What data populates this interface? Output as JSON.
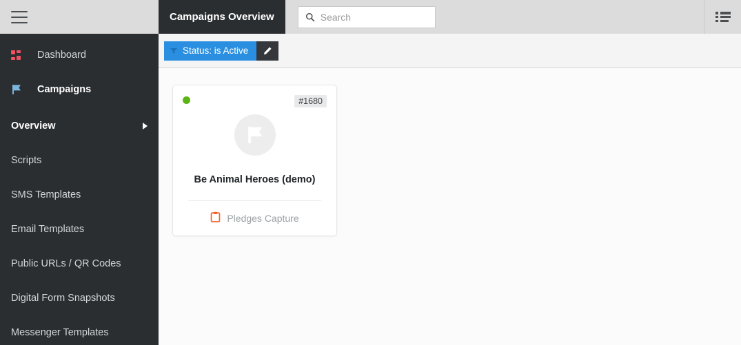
{
  "colors": {
    "sidebar_bg": "#2b2e31",
    "header_bg": "#dcdcdc",
    "accent_blue": "#2a8fe0",
    "status_green": "#5cb415",
    "dashboard_icon": "#ef5261",
    "campaigns_icon": "#7cb5dd",
    "pledges_icon": "#f4622a"
  },
  "sidebar": {
    "menu_toggle_icon": "hamburger-icon",
    "main_items": [
      {
        "label": "Dashboard",
        "icon": "grid-icon",
        "active": false
      },
      {
        "label": "Campaigns",
        "icon": "flag-icon",
        "active": true
      }
    ],
    "sub_items": [
      {
        "label": "Overview",
        "active": true,
        "caret": "caret-right-icon"
      },
      {
        "label": "Scripts",
        "active": false
      },
      {
        "label": "SMS Templates",
        "active": false
      },
      {
        "label": "Email Templates",
        "active": false
      },
      {
        "label": "Public URLs / QR Codes",
        "active": false
      },
      {
        "label": "Digital Form Snapshots",
        "active": false
      },
      {
        "label": "Messenger Templates",
        "active": false
      }
    ]
  },
  "header": {
    "title": "Campaigns Overview",
    "search": {
      "value": "",
      "placeholder": "Search",
      "icon": "search-icon"
    },
    "view_toggle_icon": "list-view-icon"
  },
  "filterbar": {
    "chip": {
      "label": "Status: is Active",
      "icon": "funnel-icon"
    },
    "edit_button_icon": "pencil-icon"
  },
  "cards": [
    {
      "id_badge": "#1680",
      "status": "active",
      "avatar_icon": "flag-icon",
      "title": "Be Animal Heroes (demo)",
      "footer_label": "Pledges Capture",
      "footer_icon": "clipboard-icon"
    }
  ]
}
